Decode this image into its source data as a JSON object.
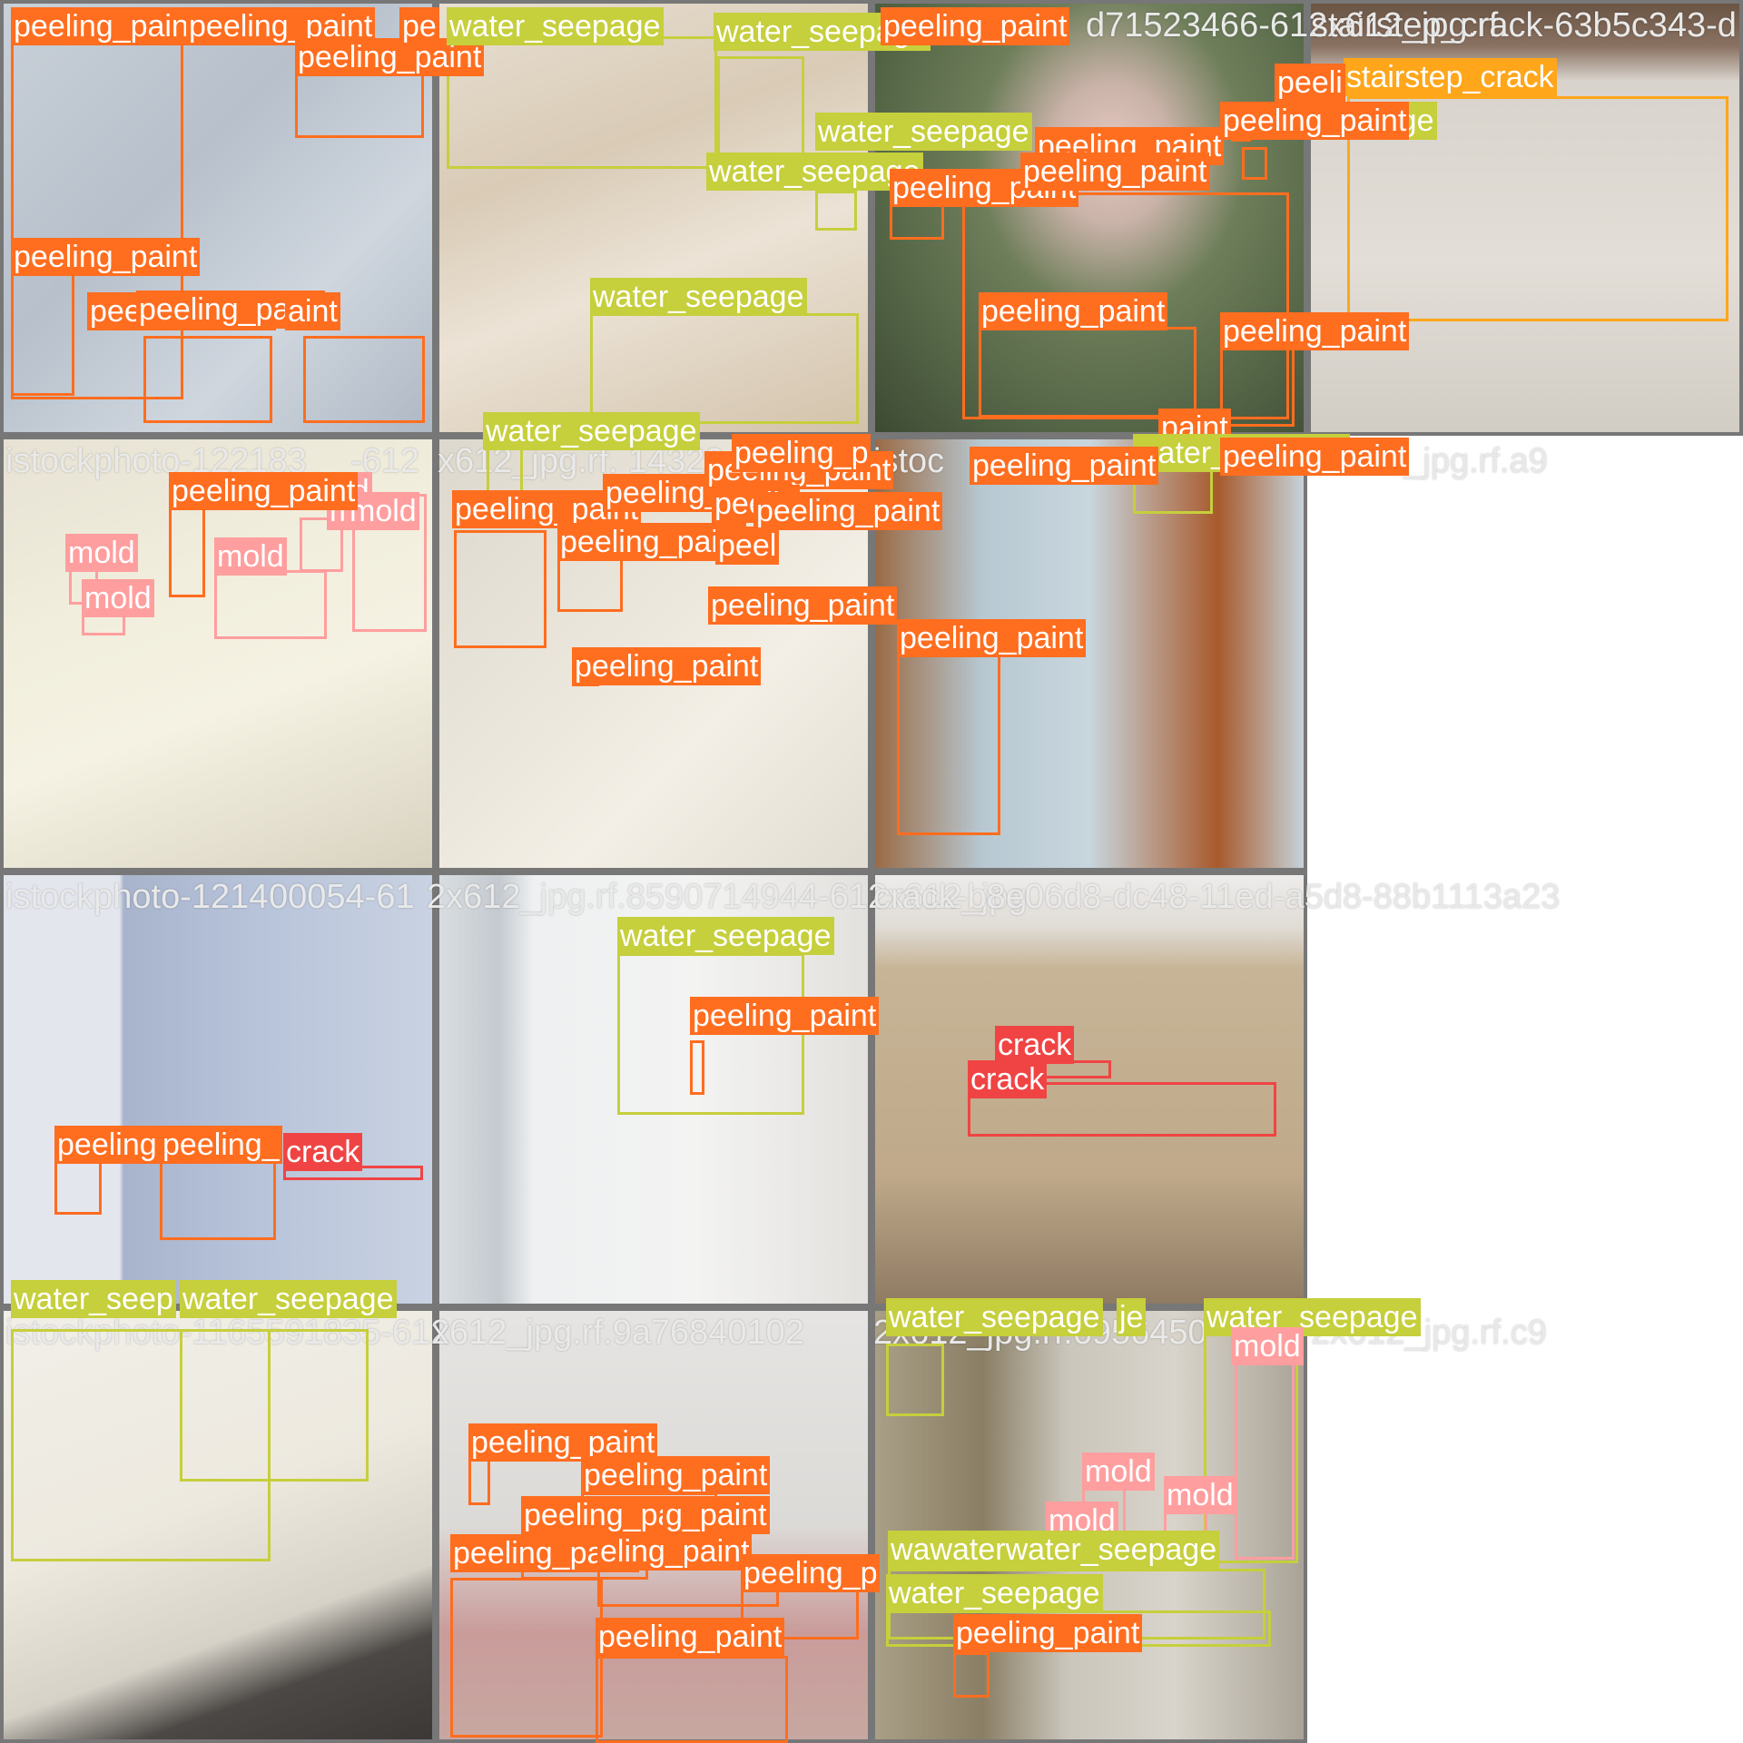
{
  "class_colors": {
    "peeling_paint": "#ff6d1f",
    "water_seepage": "#c6cf3c",
    "mold": "#ff9e9e",
    "crack": "#f04444",
    "stairstep_crack": "#ffa61a"
  },
  "filename_labels": [
    {
      "text": "istockphoto-122183",
      "tile": 4
    },
    {
      "text": "-612",
      "tile": 4
    },
    {
      "text": "x612_jpg.rf.",
      "tile": 5
    },
    {
      "text": "14329",
      "tile": 5
    },
    {
      "text": "istoc",
      "tile": 6
    },
    {
      "text": "12_jpg.rf.a9",
      "tile": 6
    },
    {
      "text": "d71523466-612x612_jpg.rf.",
      "tile": 2
    },
    {
      "text": "stairstep_crack-63b5c343-d",
      "tile": 3
    },
    {
      "text": "istockphoto-1214",
      "tile": 8
    },
    {
      "text": "00054-61",
      "tile": 8
    },
    {
      "text": "2x612_jpg.rf.8590714944-612x612_jpg",
      "tile": 9
    },
    {
      "text": "crack-b8e06d8-dc48-11ed-a5d8-88b1113a23",
      "tile": 10
    },
    {
      "text": "istockphoto-1165591835-612",
      "tile": 12
    },
    {
      "text": "x612_jpg.rf.9a76840102",
      "tile": 13
    },
    {
      "text": "2x612_jpg.rf.6956450",
      "tile": 14
    },
    {
      "text": "2x612_jpg.rf.c9",
      "tile": 14
    }
  ],
  "detections": [
    {
      "cls": "peeling_paint",
      "label": "peeling_paint"
    },
    {
      "cls": "peeling_paint",
      "label": "peeling_paint"
    },
    {
      "cls": "peeling_paint",
      "label": "peeling_paint"
    },
    {
      "cls": "peeling_paint",
      "label": "pe"
    },
    {
      "cls": "peeling_paint",
      "label": "peeling_paint"
    },
    {
      "cls": "peeling_paint",
      "label": "peeling_paint"
    },
    {
      "cls": "peeling_paint",
      "label": "peeling_paint"
    },
    {
      "cls": "peeling_paint",
      "label": "aint"
    },
    {
      "cls": "water_seepage",
      "label": "water_seepage"
    },
    {
      "cls": "water_seepage",
      "label": "water_seepage"
    },
    {
      "cls": "water_seepage",
      "label": "water_seepage"
    },
    {
      "cls": "water_seepage",
      "label": "water_seepage"
    },
    {
      "cls": "water_seepage",
      "label": "water_seepage"
    },
    {
      "cls": "peeling_paint",
      "label": "peeling_paint"
    },
    {
      "cls": "peeling_paint",
      "label": "peeling_paint"
    },
    {
      "cls": "peeling_paint",
      "label": "peeling_paint"
    },
    {
      "cls": "peeling_paint",
      "label": "peeling_paint"
    },
    {
      "cls": "peeling_paint",
      "label": "peeling_paint"
    },
    {
      "cls": "peeling_paint",
      "label": "peeling_paint"
    },
    {
      "cls": "stairstep_crack",
      "label": "stairstep_crack"
    },
    {
      "cls": "peeling_paint",
      "label": "peeli"
    },
    {
      "cls": "water_seepage",
      "label": "water_seepage"
    },
    {
      "cls": "water_seepage",
      "label": "water_seepage"
    },
    {
      "cls": "peeling_paint",
      "label": "peeling_paint"
    },
    {
      "cls": "peeling_paint",
      "label": "paint"
    },
    {
      "cls": "mold",
      "label": "mold"
    },
    {
      "cls": "mold",
      "label": "mold"
    },
    {
      "cls": "mold",
      "label": "mold"
    },
    {
      "cls": "mold",
      "label": "mold"
    },
    {
      "cls": "mold",
      "label": "mold"
    },
    {
      "cls": "mold",
      "label": "mold"
    },
    {
      "cls": "peeling_paint",
      "label": "peeling_paint"
    },
    {
      "cls": "peeling_paint",
      "label": "peeling_paint"
    },
    {
      "cls": "peeling_paint",
      "label": "peeling_paint"
    },
    {
      "cls": "peeling_paint",
      "label": "peeling_paint"
    },
    {
      "cls": "peeling_paint",
      "label": "peeling_paint"
    },
    {
      "cls": "peeling_paint",
      "label": "peel"
    },
    {
      "cls": "peeling_paint",
      "label": "peelin"
    },
    {
      "cls": "peeling_paint",
      "label": "peeling_paint"
    },
    {
      "cls": "peeling_paint",
      "label": "peeling_paint"
    },
    {
      "cls": "peeling_paint",
      "label": "peeling_paint"
    },
    {
      "cls": "peeling_paint",
      "label": "peeling_p"
    },
    {
      "cls": "water_seepage",
      "label": "water_seepage"
    },
    {
      "cls": "peeling_paint",
      "label": "peeling_paint"
    },
    {
      "cls": "peeling_paint",
      "label": "peeling_paint"
    },
    {
      "cls": "peeling_paint",
      "label": "peeling_paint"
    },
    {
      "cls": "peeling_paint",
      "label": "peeling"
    },
    {
      "cls": "peeling_paint",
      "label": "peeling_"
    },
    {
      "cls": "crack",
      "label": "crack"
    },
    {
      "cls": "water_seepage",
      "label": "water_seepage"
    },
    {
      "cls": "peeling_paint",
      "label": "peeling_paint"
    },
    {
      "cls": "crack",
      "label": "crack"
    },
    {
      "cls": "crack",
      "label": "crack"
    },
    {
      "cls": "water_seepage",
      "label": "water_seep"
    },
    {
      "cls": "water_seepage",
      "label": "water_seepage"
    },
    {
      "cls": "peeling_paint",
      "label": "peeling_paint"
    },
    {
      "cls": "peeling_paint",
      "label": "peeling_paint"
    },
    {
      "cls": "peeling_paint",
      "label": "peeling_paint"
    },
    {
      "cls": "peeling_paint",
      "label": "g_paint"
    },
    {
      "cls": "peeling_paint",
      "label": "peeling_paint"
    },
    {
      "cls": "peeling_paint",
      "label": "eling_paint"
    },
    {
      "cls": "peeling_paint",
      "label": "peeling_p"
    },
    {
      "cls": "peeling_paint",
      "label": "peeling_paint"
    },
    {
      "cls": "water_seepage",
      "label": "water_seepage"
    },
    {
      "cls": "water_seepage",
      "label": "je"
    },
    {
      "cls": "water_seepage",
      "label": "water_seepage"
    },
    {
      "cls": "mold",
      "label": "mold"
    },
    {
      "cls": "mold",
      "label": "mold"
    },
    {
      "cls": "mold",
      "label": "mold"
    },
    {
      "cls": "mold",
      "label": "mold"
    },
    {
      "cls": "water_seepage",
      "label": "wawaterwater_seepage"
    },
    {
      "cls": "water_seepage",
      "label": "water_seepage"
    },
    {
      "cls": "peeling_paint",
      "label": "peeling_paint"
    }
  ]
}
